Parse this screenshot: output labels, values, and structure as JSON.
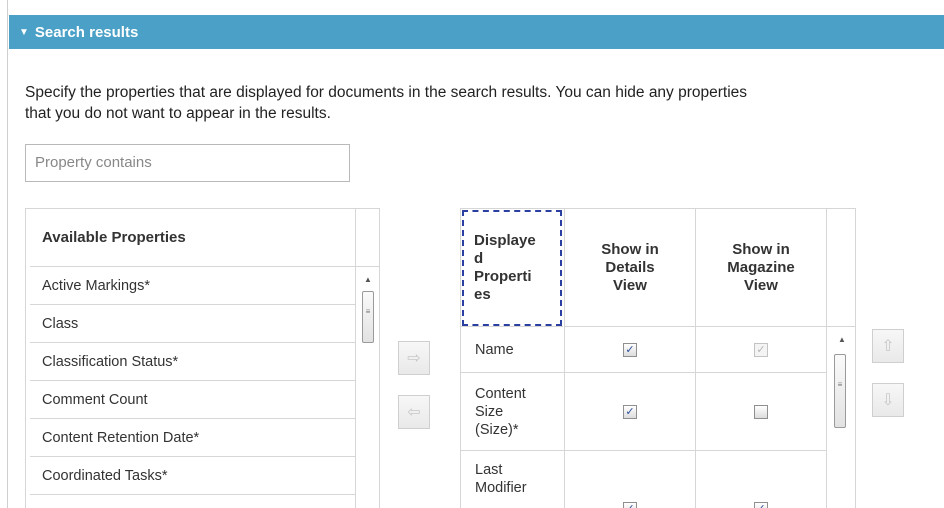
{
  "header": {
    "title": "Search results",
    "caret": "▼"
  },
  "description": {
    "line1": "Specify the properties that are displayed for documents in the search results. You can hide any properties",
    "line2": "that you do not want to appear in the results."
  },
  "filter": {
    "placeholder": "Property contains"
  },
  "available": {
    "header": "Available Properties",
    "items": [
      "Active Markings*",
      "Class",
      "Classification Status*",
      "Comment Count",
      "Content Retention Date*",
      "Coordinated Tasks*"
    ]
  },
  "move_buttons": {
    "add": "⇨",
    "remove": "⇦",
    "up": "⇧",
    "down": "⇩"
  },
  "displayed": {
    "col_name": "Displaye\nd\nProperti\nes",
    "col_details": "Show in\nDetails\nView",
    "col_magazine": "Show in\nMagazine\nView",
    "rows": [
      {
        "name": "Name",
        "details": true,
        "magazine": true,
        "magazine_disabled": true
      },
      {
        "name": "Content\nSize\n(Size)*",
        "details": true,
        "magazine": false,
        "magazine_disabled": false
      },
      {
        "name": "Last\nModifier",
        "details": true,
        "magazine": true,
        "magazine_disabled": false
      }
    ]
  },
  "icons": {
    "check": "✓",
    "scroll_up": "▲",
    "scroll_grip": "≡"
  },
  "colors": {
    "header_bg": "#4aa0c6",
    "focus_outline": "#2a3f9f",
    "check": "#2e4f9a"
  }
}
